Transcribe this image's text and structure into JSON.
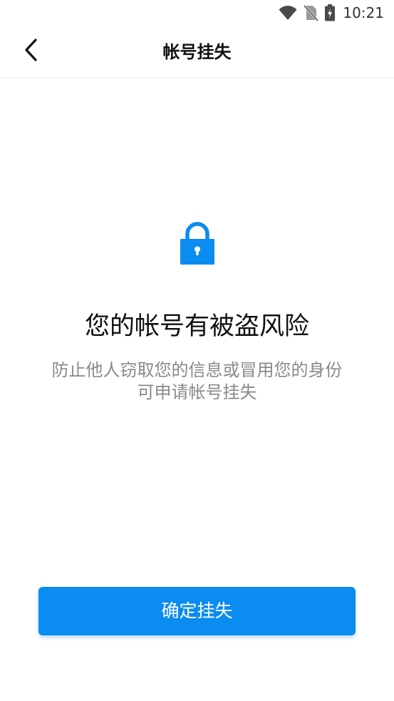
{
  "status_bar": {
    "time": "10:21",
    "icons": [
      "wifi-icon",
      "no-sim-icon",
      "battery-charging-icon"
    ]
  },
  "header": {
    "title": "帐号挂失",
    "back_icon": "chevron-left-icon"
  },
  "main": {
    "icon": "lock-icon",
    "icon_color": "#0a8cf0",
    "headline": "您的帐号有被盗风险",
    "description_line1": "防止他人窃取您的信息或冒用您的身份",
    "description_line2": "可申请帐号挂失"
  },
  "actions": {
    "confirm_label": "确定挂失",
    "confirm_color": "#0a8cf0"
  }
}
